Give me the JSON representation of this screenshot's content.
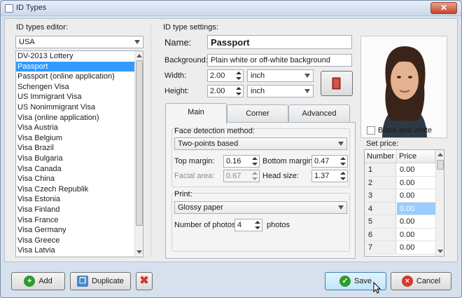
{
  "window": {
    "title": "ID Types",
    "close_glyph": "✕"
  },
  "left": {
    "label": "ID types editor:",
    "country": "USA",
    "items": [
      "DV-2013 Lottery",
      "Passport",
      "Passport (online application)",
      "Schengen Visa",
      "US Immigrant Visa",
      "US Nonimmigrant Visa",
      "Visa (online application)",
      "Visa Austria",
      "Visa Belgium",
      "Visa Brazil",
      "Visa Bulgaria",
      "Visa Canada",
      "Visa China",
      "Visa Czech Republik",
      "Visa Estonia",
      "Visa Finland",
      "Visa France",
      "Visa Germany",
      "Visa Greece",
      "Visa Latvia"
    ],
    "selected_index": 1
  },
  "settings": {
    "label": "ID type settings:",
    "name_label": "Name:",
    "name_value": "Passport",
    "background_label": "Background:",
    "background_value": "Plain white or off-white background",
    "width_label": "Width:",
    "width_value": "2.00",
    "width_unit": "inch",
    "height_label": "Height:",
    "height_value": "2.00",
    "height_unit": "inch"
  },
  "tabs": [
    "Main",
    "Corner",
    "Advanced"
  ],
  "active_tab": "Main",
  "main": {
    "face_method_label": "Face detection method:",
    "face_method_value": "Two-points based",
    "top_margin_label": "Top margin:",
    "top_margin_value": "0.16",
    "bottom_margin_label": "Bottom margin:",
    "bottom_margin_value": "0.47",
    "facial_area_label": "Facial area:",
    "facial_area_value": "0.67",
    "head_size_label": "Head size:",
    "head_size_value": "1.37",
    "print_label": "Print:",
    "print_value": "Glossy paper",
    "num_photos_label": "Number of photos:",
    "num_photos_value": "4",
    "num_photos_unit": "photos"
  },
  "photo": {
    "bw_label": "Black and white",
    "bw_checked": false
  },
  "price": {
    "label": "Set price:",
    "col_number": "Number",
    "col_price": "Price",
    "rows": [
      {
        "n": "1",
        "p": "0.00"
      },
      {
        "n": "2",
        "p": "0.00"
      },
      {
        "n": "3",
        "p": "0.00"
      },
      {
        "n": "4",
        "p": "0.00"
      },
      {
        "n": "5",
        "p": "0.00"
      },
      {
        "n": "6",
        "p": "0.00"
      },
      {
        "n": "7",
        "p": "0.00"
      }
    ],
    "selected_row": 3
  },
  "buttons": {
    "add": "Add",
    "duplicate": "Duplicate",
    "save": "Save",
    "cancel": "Cancel"
  },
  "colors": {
    "selection": "#3399ff",
    "save_hover": "#bee6fd",
    "add_icon": "#2e9a2e",
    "cancel_icon": "#d43a2a",
    "delete_icon": "#d43a2a"
  }
}
